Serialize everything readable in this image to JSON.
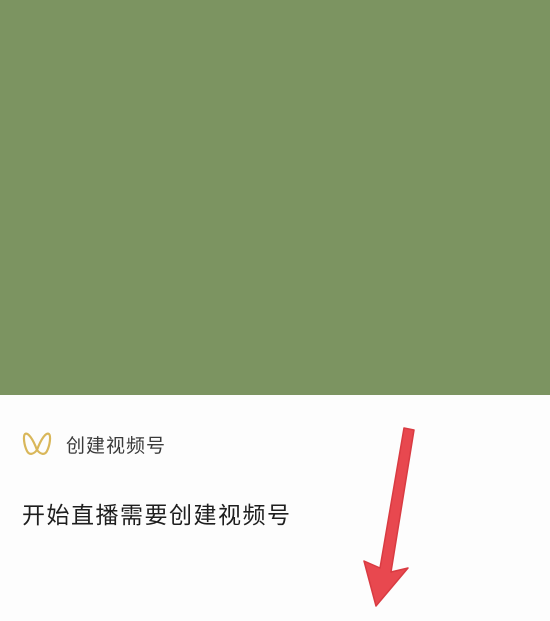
{
  "cover": {
    "color": "#7c9461"
  },
  "sheet": {
    "header": {
      "icon": "channels-butterfly-icon",
      "icon_color": "#d9b75a",
      "title": "创建视频号"
    },
    "message": "开始直播需要创建视频号"
  },
  "annotation": {
    "icon": "red-arrow-down-icon",
    "color": "#e8484f"
  }
}
